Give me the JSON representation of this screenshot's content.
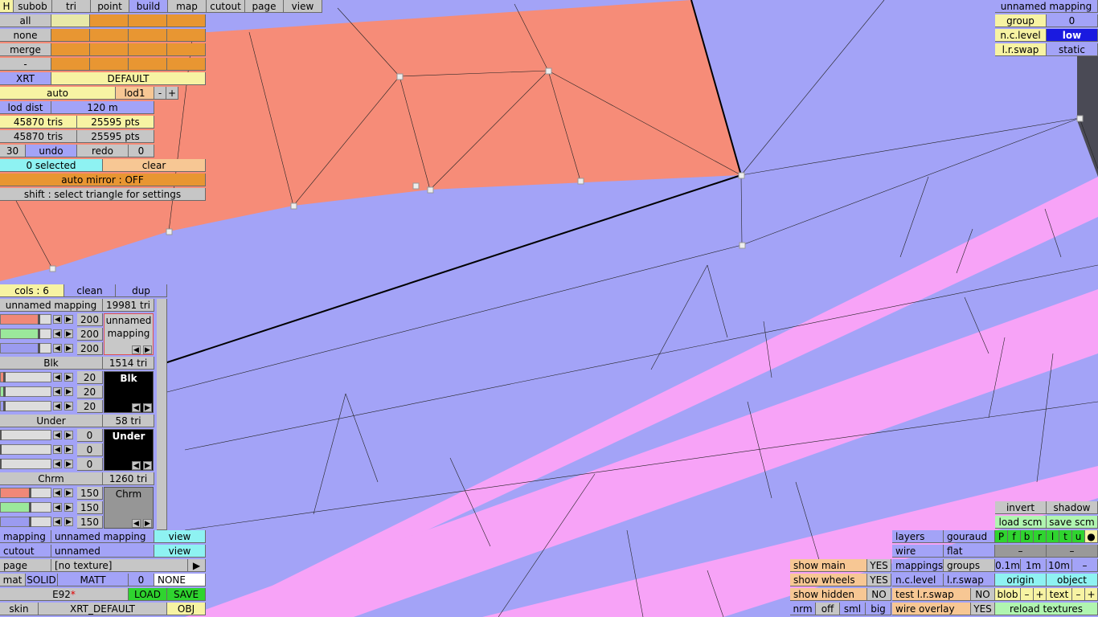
{
  "top_menu": [
    "H",
    "subob",
    "tri",
    "point",
    "build",
    "map",
    "cutout",
    "page",
    "view"
  ],
  "left_panel": {
    "all": "all",
    "none": "none",
    "merge": "merge",
    "minus": "-",
    "xrt": "XRT",
    "default": "DEFAULT",
    "auto": "auto",
    "lod": "lod1",
    "lod_minus": "-",
    "lod_plus": "+",
    "lod_dist_label": "lod dist",
    "lod_dist_value": "120 m",
    "tris1": "45870 tris",
    "pts1": "25595 pts",
    "tris2": "45870 tris",
    "pts2": "25595 pts",
    "undo_count": "30",
    "undo": "undo",
    "redo": "redo",
    "redo_count": "0",
    "selected": "0 selected",
    "clear": "clear",
    "auto_mirror": "auto mirror : OFF",
    "shift_hint": "shift : select triangle for settings"
  },
  "cols_bar": {
    "cols": "cols : 6",
    "clean": "clean",
    "dup": "dup"
  },
  "materials": [
    {
      "name": "unnamed mapping",
      "tri": "19981 tri",
      "r": "200",
      "g": "200",
      "b": "200",
      "preview": "unnamed\nmapping",
      "swatch": "#c8c8c8",
      "text": "#000000",
      "level": 0.78
    },
    {
      "name": "Blk",
      "tri": "1514 tri",
      "r": "20",
      "g": "20",
      "b": "20",
      "preview": "Blk",
      "swatch": "#000000",
      "text": "#ffffff",
      "level": 0.08
    },
    {
      "name": "Under",
      "tri": "58 tri",
      "r": "0",
      "g": "0",
      "b": "0",
      "preview": "Under",
      "swatch": "#000000",
      "text": "#ffffff",
      "level": 0.0
    },
    {
      "name": "Chrm",
      "tri": "1260 tri",
      "r": "150",
      "g": "150",
      "b": "150",
      "preview": "Chrm",
      "swatch": "#969696",
      "text": "#000000",
      "level": 0.59
    }
  ],
  "bottom_left": {
    "mapping_label": "mapping",
    "mapping_value": "unnamed mapping",
    "mapping_view": "view",
    "cutout_label": "cutout",
    "cutout_value": "unnamed",
    "cutout_view": "view",
    "page_label": "page",
    "page_value": "[no texture]",
    "page_arrow": "▶",
    "mat": "mat",
    "solid": "SOLID",
    "matt": "MATT",
    "mat_num": "0",
    "none": "NONE",
    "model": "E92",
    "star": "*",
    "load": "LOAD",
    "save": "SAVE",
    "skin": "skin",
    "skin_value": "XRT_DEFAULT",
    "obj": "OBJ"
  },
  "top_right": {
    "title": "unnamed mapping",
    "group": "group",
    "group_value": "0",
    "nc_level": "n.c.level",
    "nc_value": "low",
    "lr_swap": "l.r.swap",
    "lr_value": "static"
  },
  "bottom_center": {
    "show_main": "show main",
    "show_main_v": "YES",
    "show_wheels": "show wheels",
    "show_wheels_v": "YES",
    "show_hidden": "show hidden",
    "show_hidden_v": "NO",
    "nrm": "nrm",
    "off": "off",
    "sml": "sml",
    "big": "big"
  },
  "bottom_right": {
    "layers": "layers",
    "gouraud": "gouraud",
    "wire": "wire",
    "flat": "flat",
    "mappings": "mappings",
    "groups": "groups",
    "nc_level": "n.c.level",
    "lr_swap": "l.r.swap",
    "test_lr": "test l.r.swap",
    "test_lr_v": "NO",
    "wire_overlay": "wire overlay",
    "wire_overlay_v": "YES",
    "invert": "invert",
    "shadow": "shadow",
    "load_scm": "load scm",
    "save_scm": "save scm",
    "flags": [
      "P",
      "f",
      "b",
      "r",
      "l",
      "t",
      "u",
      "●"
    ],
    "dash1": "–",
    "dash2": "–",
    "d01": "0.1m",
    "d1": "1m",
    "d10": "10m",
    "dminus": "–",
    "origin": "origin",
    "object": "object",
    "blob": "blob",
    "blob_minus": "–",
    "blob_plus": "+",
    "text": "text",
    "text_minus": "–",
    "text_plus": "+",
    "reload": "reload textures"
  }
}
